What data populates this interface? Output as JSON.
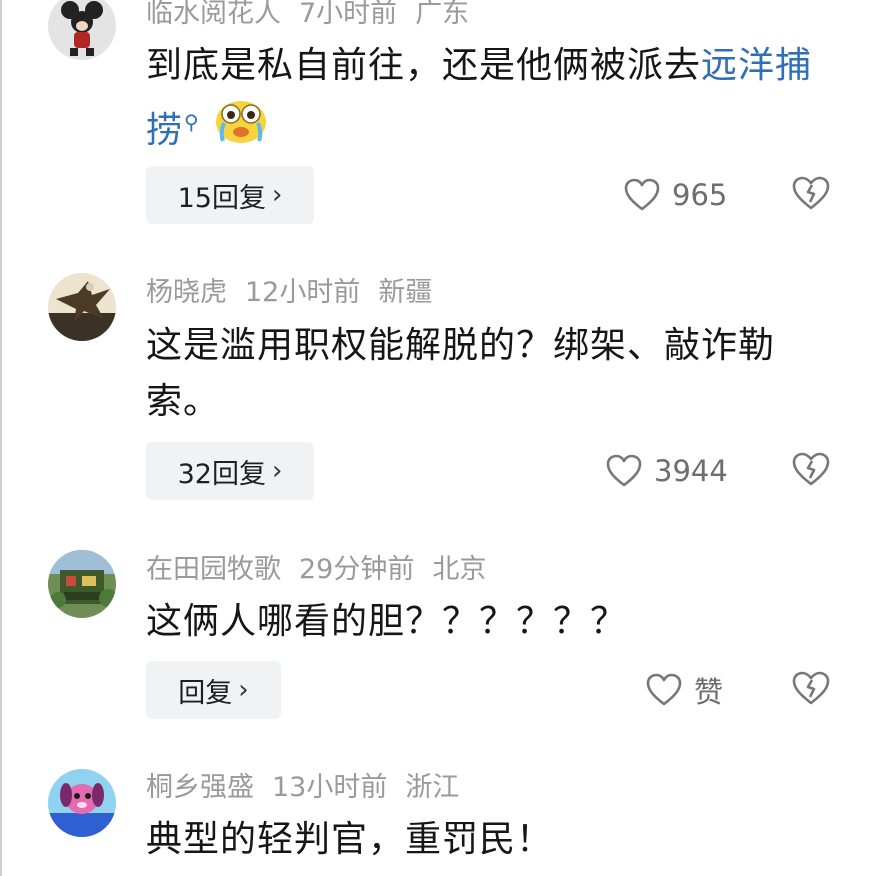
{
  "comments": [
    {
      "user": "临水阅花人",
      "time": "7小时前",
      "location": "广东",
      "text_plain": "到底是私自前往，还是他俩被派去",
      "text_link": "远洋捕捞",
      "replies": "15回复",
      "likes": "965",
      "avatar_icon": "cartoon-mouse-avatar"
    },
    {
      "user": "杨晓虎",
      "time": "12小时前",
      "location": "新疆",
      "text_plain": "这是滥用职权能解脱的？绑架、敲诈勒索。",
      "replies": "32回复",
      "likes": "3944",
      "avatar_icon": "eagle-photo-avatar"
    },
    {
      "user": "在田园牧歌",
      "time": "29分钟前",
      "location": "北京",
      "text_plain": "这俩人哪看的胆？？？？？？",
      "replies": "回复",
      "likes": "赞",
      "avatar_icon": "garden-photo-avatar"
    },
    {
      "user": "桐乡强盛",
      "time": "13小时前",
      "location": "浙江",
      "text_plain": "典型的轻判官，重罚民！",
      "avatar_icon": "pink-dog-avatar"
    }
  ],
  "icons": {
    "reply_chevron": "›",
    "search_mark": "⚲",
    "like": "heart-outline-icon",
    "dislike": "broken-heart-icon",
    "emoji": "crying-face-emoji"
  },
  "colors": {
    "link": "#2f6fb7",
    "meta_text": "#9a9a9a",
    "reply_button_bg": "#f1f2f4"
  }
}
